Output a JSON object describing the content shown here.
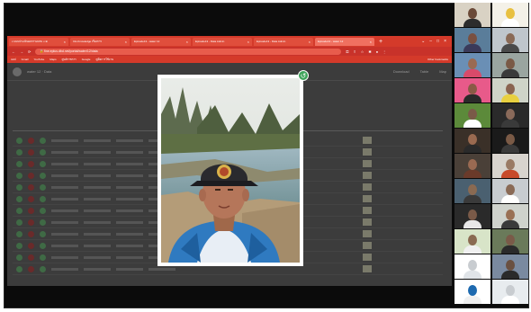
{
  "browser": {
    "tabs": [
      {
        "label": "ᴄ แบบประเมินผลการอบรม x ⊕"
      },
      {
        "label": "CH-Knowledge เรื่องการ"
      },
      {
        "label": "Episode13 - water 12"
      },
      {
        "label": "Episode13 - Data Admin"
      },
      {
        "label": "Episode13 - Data Admin"
      },
      {
        "label": "Episode13 - water 12"
      }
    ],
    "new_tab": "+",
    "url": "fine.eplus.dbd.net/portal/water/12/data",
    "bookmarks": [
      "แอป",
      "Gmail",
      "YouTube",
      "Maps",
      "ศูนย์ราชการ",
      "Google",
      "คู่มือการใช้งาน"
    ],
    "bookmarks_other": "Other bookmarks"
  },
  "app": {
    "header": "water 12 · Data",
    "actions": [
      "Download",
      "Table",
      "Map"
    ]
  },
  "colors": {
    "tab_bar": "#d43a2a",
    "close_button": "#3ea35a",
    "overlay": "#3c3c3c"
  }
}
